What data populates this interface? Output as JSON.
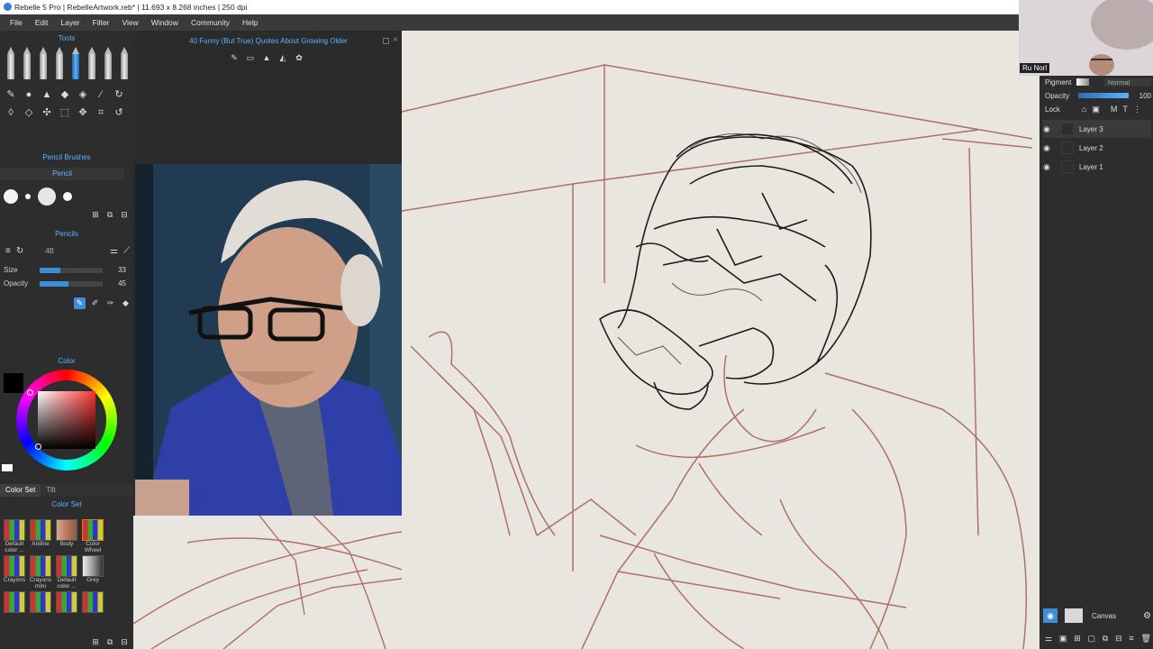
{
  "window": {
    "title": "Rebelle 5 Pro | RebelleArtwork.reb* | 11.693 x 8.268 inches | 250 dpi"
  },
  "menu": [
    "File",
    "Edit",
    "Layer",
    "Filter",
    "View",
    "Window",
    "Community",
    "Help"
  ],
  "tools_panel": {
    "title": "Tools"
  },
  "reference_panel": {
    "title": "40 Funny (But True) Quotes About Growing Older"
  },
  "pencil_brushes": {
    "title": "Pencil Brushes",
    "category": "Pencil"
  },
  "pencils": {
    "title": "Pencils",
    "grade": "4B",
    "size_label": "Size",
    "size_value": "33",
    "size_fraction": 0.33,
    "opacity_label": "Opacity",
    "opacity_value": "45",
    "opacity_fraction": 0.45
  },
  "color_panel": {
    "title": "Color",
    "selected_color": "#000000"
  },
  "color_set": {
    "tabs": [
      "Color Set",
      "Tilt"
    ],
    "title": "Color Set",
    "items": [
      {
        "label": "Default color ..."
      },
      {
        "label": "Aniline"
      },
      {
        "label": "Body"
      },
      {
        "label": "Color Wheel"
      },
      {
        "label": "Crayons"
      },
      {
        "label": "Crayons mini"
      },
      {
        "label": "Default color ..."
      },
      {
        "label": "Grey"
      },
      {
        "label": ""
      },
      {
        "label": ""
      },
      {
        "label": ""
      },
      {
        "label": ""
      }
    ]
  },
  "webcam": {
    "name_tag": "Ru Norl"
  },
  "layers_panel": {
    "pigment_label": "Pigment",
    "blend_mode": "Normal",
    "opacity_label": "Opacity",
    "opacity_value": "100",
    "lock_label": "Lock",
    "layers": [
      {
        "name": "Layer 3",
        "selected": true
      },
      {
        "name": "Layer 2",
        "selected": false
      },
      {
        "name": "Layer 1",
        "selected": false
      }
    ],
    "canvas_label": "Canvas"
  },
  "colors": {
    "accent": "#5ab3ff",
    "sketch_red": "#a0524a",
    "sketch_black": "#1c1c1c"
  }
}
